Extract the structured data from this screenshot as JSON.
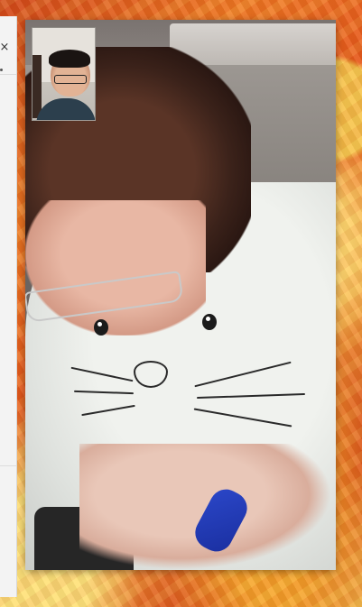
{
  "side_panel": {
    "close_icon": "close-icon",
    "close_glyph": "×"
  },
  "call": {
    "remote_video": "remote-video-feed",
    "self_preview": "self-view-preview"
  }
}
